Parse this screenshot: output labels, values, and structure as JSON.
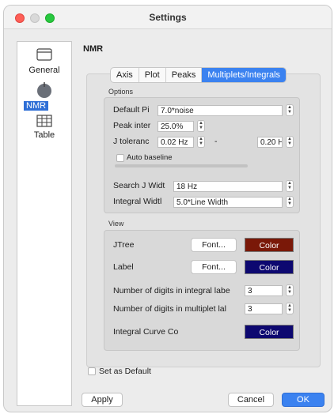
{
  "window": {
    "title": "Settings"
  },
  "sidebar": {
    "items": [
      {
        "label": "General",
        "icon": "window-icon",
        "selected": false
      },
      {
        "label": "NMR",
        "icon": "magnet-ball-icon",
        "selected": true
      },
      {
        "label": "Table",
        "icon": "table-icon",
        "selected": false
      }
    ]
  },
  "panel": {
    "title": "NMR"
  },
  "tabs": [
    {
      "label": "Axis",
      "active": false
    },
    {
      "label": "Plot",
      "active": false
    },
    {
      "label": "Peaks",
      "active": false
    },
    {
      "label": "Multiplets/Integrals",
      "active": true
    }
  ],
  "options": {
    "group_label": "Options",
    "default_peak_label": "Default Pi",
    "default_peak_value": "7.0*noise",
    "peak_interval_label": "Peak inter",
    "peak_interval_value": "25.0%",
    "j_tolerance_label": "J toleranc",
    "j_tolerance_min": "0.02 Hz",
    "j_tolerance_sep": "-",
    "j_tolerance_max": "0.20 H",
    "auto_baseline_label": "Auto baseline",
    "search_j_label": "Search J Widt",
    "search_j_value": "18 Hz",
    "integral_width_label": "Integral Widtl",
    "integral_width_value": "5.0*Line Width"
  },
  "view": {
    "group_label": "View",
    "jtree_label": "JTree",
    "label_label": "Label",
    "font_button": "Font...",
    "color_button": "Color",
    "digits_integral_label": "Number of digits in integral labe",
    "digits_integral_value": "3",
    "digits_multiplet_label": "Number of digits in multiplet lal",
    "digits_multiplet_value": "3",
    "integral_curve_label": "Integral Curve Co",
    "jtree_color": "#7a1808",
    "label_color": "#0d0870",
    "integral_curve_color": "#0d0870"
  },
  "footer": {
    "set_default_label": "Set as Default",
    "apply": "Apply",
    "cancel": "Cancel",
    "ok": "OK"
  },
  "colors": {
    "accent": "#3b82f0"
  }
}
